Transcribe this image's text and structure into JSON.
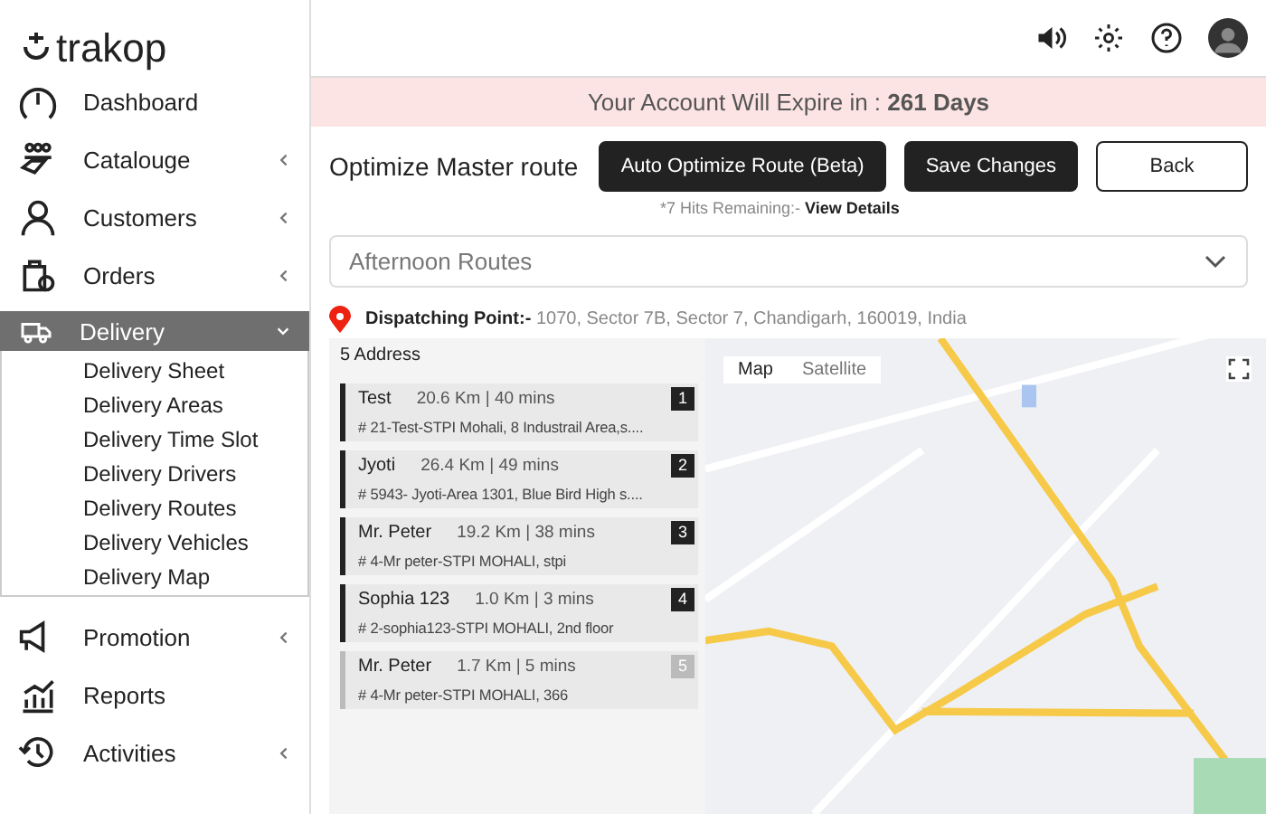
{
  "sidebar": {
    "logo": "trakop",
    "items": [
      {
        "label": "Dashboard",
        "has_arrow": false,
        "selected": false
      },
      {
        "label": "Catalouge",
        "has_arrow": true,
        "expanded": false,
        "selected": false
      },
      {
        "label": "Customers",
        "has_arrow": true,
        "expanded": false,
        "selected": false
      },
      {
        "label": "Orders",
        "has_arrow": true,
        "expanded": false,
        "selected": false
      },
      {
        "label": "Delivery",
        "has_arrow": true,
        "expanded": true,
        "selected": true,
        "children": [
          "Delivery Sheet",
          "Delivery Areas",
          "Delivery Time Slot",
          "Delivery Drivers",
          "Delivery Routes",
          "Delivery Vehicles",
          "Delivery Map"
        ]
      },
      {
        "label": "Promotion",
        "has_arrow": true,
        "expanded": false,
        "selected": false
      },
      {
        "label": "Reports",
        "has_arrow": false,
        "selected": false
      },
      {
        "label": "Activities",
        "has_arrow": true,
        "expanded": false,
        "selected": false
      }
    ]
  },
  "banner": {
    "text": "Your Account Will Expire in : **261 Days**"
  },
  "page_title": "Optimize Master route",
  "buttons": [
    {
      "label": "Auto Optimize Route (Beta)",
      "kind": "primary"
    },
    {
      "label": "Save Changes",
      "kind": "primary"
    },
    {
      "label": "Back",
      "kind": "outline"
    }
  ],
  "hits_note": "*7 Hits Remaining:-",
  "view_details": "View Details",
  "route_select": {
    "value": "Afternoon Routes"
  },
  "dispatch": {
    "label": "Dispatching Point:-",
    "address": "1070, Sector 7B, Sector 7, Chandigarh, 160019, India"
  },
  "address_list": {
    "title": "5 Address",
    "items": [
      {
        "name": "Test",
        "distance": "20.6 Km  |  40 mins",
        "address": "# 21-Test-STPI Mohali, 8 Industrail Area,s....",
        "number": "1",
        "disabled": false
      },
      {
        "name": "Jyoti",
        "distance": "26.4 Km  |  49 mins",
        "address": "# 5943- Jyoti-Area 1301, Blue Bird High s....",
        "number": "2",
        "disabled": false
      },
      {
        "name": "Mr. Peter",
        "distance": "19.2 Km  |  38 mins",
        "address": "# 4-Mr peter-STPI MOHALI, stpi",
        "number": "3",
        "disabled": false
      },
      {
        "name": "Sophia 123",
        "distance": "1.0 Km  |  3 mins",
        "address": "# 2-sophia123-STPI MOHALI, 2nd floor",
        "number": "4",
        "disabled": false
      },
      {
        "name": "Mr. Peter",
        "distance": "1.7 Km  |  5 mins",
        "address": "# 4-Mr peter-STPI MOHALI, 366",
        "number": "5",
        "disabled": true
      }
    ]
  },
  "map": {
    "tabs": [
      {
        "label": "Map",
        "selected": true
      },
      {
        "label": "Satellite",
        "selected": false
      }
    ]
  }
}
